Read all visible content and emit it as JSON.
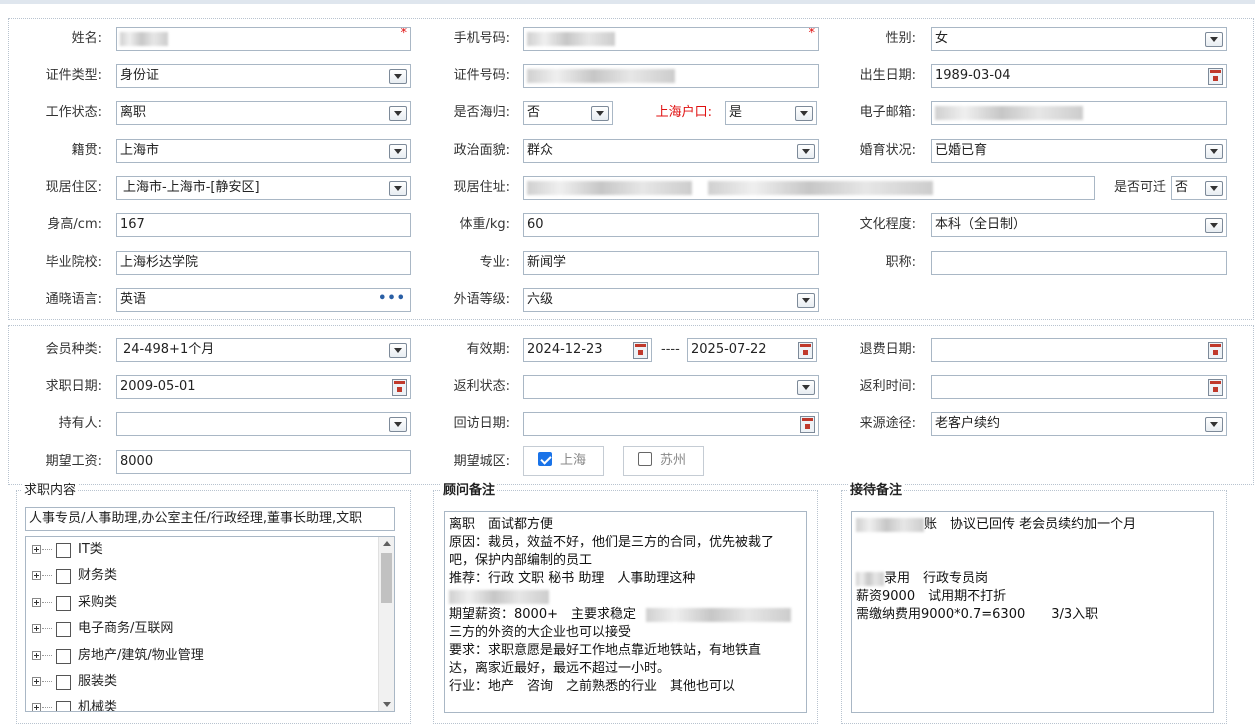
{
  "labels": {
    "name": "姓名:",
    "phone": "手机号码:",
    "gender": "性别:",
    "idtype": "证件类型:",
    "idno": "证件号码:",
    "birth": "出生日期:",
    "work": "工作状态:",
    "overseas": "是否海归:",
    "shhukou": "上海户口:",
    "email": "电子邮箱:",
    "native": "籍贯:",
    "political": "政治面貌:",
    "marital": "婚育状况:",
    "region": "现居住区:",
    "address": "现居住址:",
    "relocate": "是否可迁",
    "height": "身高/cm:",
    "weight": "体重/kg:",
    "education": "文化程度:",
    "school": "毕业院校:",
    "major": "专业:",
    "title": "职称:",
    "lang": "通晓语言:",
    "langlevel": "外语等级:",
    "member": "会员种类:",
    "valid": "有效期:",
    "refund": "退费日期:",
    "jobdate": "求职日期:",
    "rebate": "返利状态:",
    "rebatetime": "返利时间:",
    "holder": "持有人:",
    "visit": "回访日期:",
    "source": "来源途径:",
    "salary": "期望工资:",
    "city": "期望城区:"
  },
  "values": {
    "required_mark": "*",
    "gender": "女",
    "idtype": "身份证",
    "birth": "1989-03-04",
    "work": "离职",
    "overseas": "否",
    "shhukou": "是",
    "native": "上海市",
    "political": "群众",
    "marital": "已婚已育",
    "region": "上海市-上海市-[静安区]",
    "relocate": "否",
    "height": "167",
    "weight": "60",
    "education": "本科（全日制）",
    "school": "上海杉达学院",
    "major": "新闻学",
    "lang": "英语",
    "lang_more": "•••",
    "langlevel": "六级",
    "member": "24-498+1个月",
    "valid_from": "2024-12-23",
    "valid_sep": "----",
    "valid_to": "2025-07-22",
    "jobdate": "2009-05-01",
    "source": "老客户续约",
    "salary": "8000",
    "city_shanghai": "上海",
    "city_suzhou": "苏州"
  },
  "jobcontent": {
    "title": "求职内容",
    "text": "人事专员/人事助理,办公室主任/行政经理,董事长助理,文职",
    "tree": [
      "IT类",
      "财务类",
      "采购类",
      "电子商务/互联网",
      "房地产/建筑/物业管理",
      "服装类",
      "机械类"
    ]
  },
  "consultant": {
    "title": "顾问备注",
    "lines": [
      "离职　面试都方便",
      "原因：裁员，效益不好，他们是三方的合同，优先被裁了",
      "吧，保护内部编制的员工",
      "推荐：行政 文职 秘书 助理　人事助理这种",
      "",
      "期望薪资：8000+　主要求稳定",
      "三方的外资的大企业也可以接受",
      "要求：求职意愿是最好工作地点靠近地铁站，有地铁直",
      "达，离家近最好，最远不超过一小时。",
      "行业：地产　咨询　之前熟悉的行业　其他也可以"
    ]
  },
  "reception": {
    "title": "接待备注",
    "lines": [
      "账　协议已回传 老会员续约加一个月",
      "",
      "",
      "录用　行政专员岗",
      "薪资9000　试用期不打折",
      "需缴纳费用9000*0.7=6300　　3/3入职"
    ]
  }
}
